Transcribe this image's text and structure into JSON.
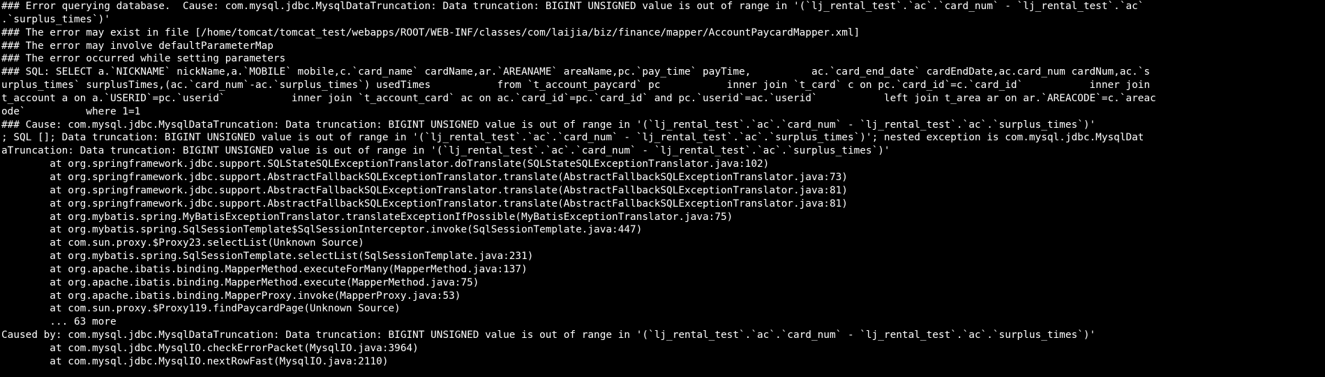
{
  "terminal": {
    "lines": [
      "### Error querying database.  Cause: com.mysql.jdbc.MysqlDataTruncation: Data truncation: BIGINT UNSIGNED value is out of range in '(`lj_rental_test`.`ac`.`card_num` - `lj_rental_test`.`ac`",
      ".`surplus_times`)'",
      "### The error may exist in file [/home/tomcat/tomcat_test/webapps/ROOT/WEB-INF/classes/com/laijia/biz/finance/mapper/AccountPaycardMapper.xml]",
      "### The error may involve defaultParameterMap",
      "### The error occurred while setting parameters",
      "### SQL: SELECT a.`NICKNAME` nickName,a.`MOBILE` mobile,c.`card_name` cardName,ar.`AREANAME` areaName,pc.`pay_time` payTime,          ac.`card_end_date` cardEndDate,ac.card_num cardNum,ac.`s",
      "urplus_times` surplusTimes,(ac.`card_num`-ac.`surplus_times`) usedTimes           from `t_account_paycard` pc           inner join `t_card` c on pc.`card_id`=c.`card_id`           inner join",
      "t_account a on a.`USERID`=pc.`userid`           inner join `t_account_card` ac on ac.`card_id`=pc.`card_id` and pc.`userid`=ac.`userid`           left join t_area ar on ar.`AREACODE`=c.`areac",
      "ode`          where 1=1",
      "### Cause: com.mysql.jdbc.MysqlDataTruncation: Data truncation: BIGINT UNSIGNED value is out of range in '(`lj_rental_test`.`ac`.`card_num` - `lj_rental_test`.`ac`.`surplus_times`)'",
      "; SQL []; Data truncation: BIGINT UNSIGNED value is out of range in '(`lj_rental_test`.`ac`.`card_num` - `lj_rental_test`.`ac`.`surplus_times`)'; nested exception is com.mysql.jdbc.MysqlDat",
      "aTruncation: Data truncation: BIGINT UNSIGNED value is out of range in '(`lj_rental_test`.`ac`.`card_num` - `lj_rental_test`.`ac`.`surplus_times`)'",
      "        at org.springframework.jdbc.support.SQLStateSQLExceptionTranslator.doTranslate(SQLStateSQLExceptionTranslator.java:102)",
      "        at org.springframework.jdbc.support.AbstractFallbackSQLExceptionTranslator.translate(AbstractFallbackSQLExceptionTranslator.java:73)",
      "        at org.springframework.jdbc.support.AbstractFallbackSQLExceptionTranslator.translate(AbstractFallbackSQLExceptionTranslator.java:81)",
      "        at org.springframework.jdbc.support.AbstractFallbackSQLExceptionTranslator.translate(AbstractFallbackSQLExceptionTranslator.java:81)",
      "        at org.mybatis.spring.MyBatisExceptionTranslator.translateExceptionIfPossible(MyBatisExceptionTranslator.java:75)",
      "        at org.mybatis.spring.SqlSessionTemplate$SqlSessionInterceptor.invoke(SqlSessionTemplate.java:447)",
      "        at com.sun.proxy.$Proxy23.selectList(Unknown Source)",
      "        at org.mybatis.spring.SqlSessionTemplate.selectList(SqlSessionTemplate.java:231)",
      "        at org.apache.ibatis.binding.MapperMethod.executeForMany(MapperMethod.java:137)",
      "        at org.apache.ibatis.binding.MapperMethod.execute(MapperMethod.java:75)",
      "        at org.apache.ibatis.binding.MapperProxy.invoke(MapperProxy.java:53)",
      "        at com.sun.proxy.$Proxy119.findPaycardPage(Unknown Source)",
      "        ... 63 more",
      "Caused by: com.mysql.jdbc.MysqlDataTruncation: Data truncation: BIGINT UNSIGNED value is out of range in '(`lj_rental_test`.`ac`.`card_num` - `lj_rental_test`.`ac`.`surplus_times`)'",
      "        at com.mysql.jdbc.MysqlIO.checkErrorPacket(MysqlIO.java:3964)",
      "        at com.mysql.jdbc.MysqlIO.nextRowFast(MysqlIO.java:2110)"
    ]
  }
}
